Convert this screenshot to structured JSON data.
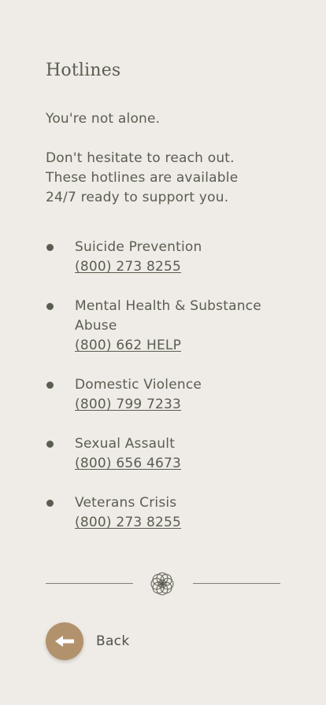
{
  "page": {
    "title": "Hotlines"
  },
  "intro": {
    "line1": "You're not alone.",
    "line2": "Don't hesitate to reach out.",
    "line3": "These hotlines are available",
    "line4": "24/7 ready to support you."
  },
  "hotlines": [
    {
      "name": "Suicide Prevention",
      "phone": "(800) 273 8255"
    },
    {
      "name": "Mental Health & Substance Abuse",
      "phone": "(800) 662 HELP"
    },
    {
      "name": "Domestic Violence",
      "phone": "(800) 799 7233"
    },
    {
      "name": "Sexual Assault",
      "phone": "(800) 656 4673"
    },
    {
      "name": "Veterans Crisis",
      "phone": "(800) 273 8255"
    }
  ],
  "divider": {
    "icon": "flower-ornament-icon"
  },
  "navigation": {
    "back_label": "Back",
    "back_icon": "arrow-left-icon"
  },
  "colors": {
    "background": "#efebe6",
    "text": "#5b5d50",
    "accent": "#b2926c"
  }
}
